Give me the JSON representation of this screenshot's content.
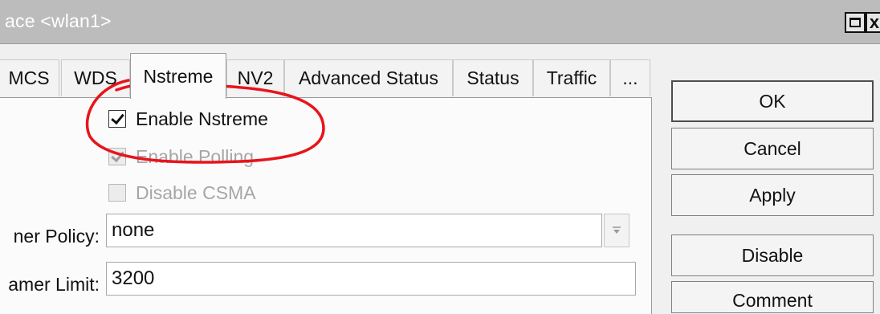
{
  "window": {
    "title": "ace <wlan1>",
    "maximize_icon": "maximize-icon",
    "close_icon": "close-icon",
    "close_glyph": "x"
  },
  "tabs": [
    {
      "label": "MCS"
    },
    {
      "label": "WDS"
    },
    {
      "label": "Nstreme",
      "active": true
    },
    {
      "label": "NV2"
    },
    {
      "label": "Advanced Status"
    },
    {
      "label": "Status"
    },
    {
      "label": "Traffic"
    },
    {
      "label": "..."
    }
  ],
  "options": {
    "enable_nstreme": {
      "label": "Enable Nstreme",
      "checked": true,
      "enabled": true
    },
    "enable_polling": {
      "label": "Enable Polling",
      "checked": true,
      "enabled": false
    },
    "disable_csma": {
      "label": "Disable CSMA",
      "checked": false,
      "enabled": false
    }
  },
  "fields": {
    "framer_policy": {
      "label": "ner Policy:",
      "value": "none"
    },
    "framer_limit": {
      "label": "amer Limit:",
      "value": "3200"
    }
  },
  "buttons": {
    "ok": "OK",
    "cancel": "Cancel",
    "apply": "Apply",
    "disable": "Disable",
    "comment": "Comment"
  },
  "annotation": {
    "color": "#e8141b"
  }
}
